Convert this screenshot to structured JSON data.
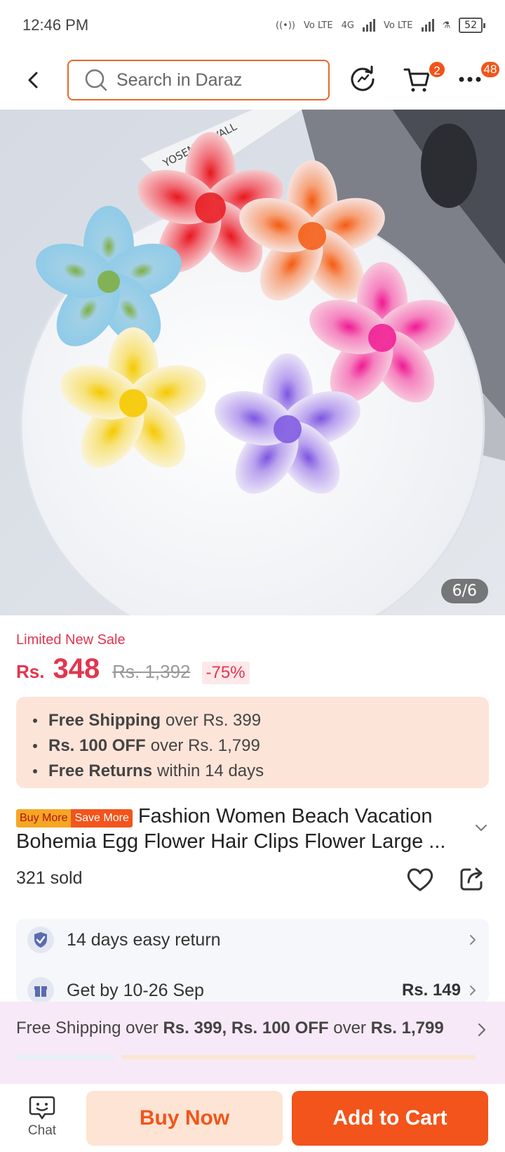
{
  "status_bar": {
    "time": "12:46 PM",
    "network_1": "Vo LTE",
    "network_2": "4G",
    "network_3": "Vo LTE",
    "battery": "52"
  },
  "header": {
    "search_placeholder": "Search in Daraz",
    "cart_count": "2",
    "more_count": "48"
  },
  "gallery": {
    "counter": "6/6",
    "sign_text": "YOSEMITE VALL"
  },
  "price": {
    "sale_label": "Limited New Sale",
    "currency": "Rs.",
    "current": "348",
    "original": "Rs. 1,392",
    "discount": "-75%"
  },
  "promos": [
    {
      "bold": "Free Shipping",
      "rest": "over Rs. 399"
    },
    {
      "bold": "Rs. 100 OFF",
      "rest": "over Rs. 1,799"
    },
    {
      "bold": "Free Returns",
      "rest": "within 14 days"
    }
  ],
  "product": {
    "badge_1": "Buy More",
    "badge_2": "Save More",
    "title": "Fashion Women Beach Vacation Bohemia Egg Flower Hair Clips Flower Large ...",
    "sold": "321 sold"
  },
  "service": {
    "return": "14 days easy return",
    "delivery": "Get by 10-26 Sep",
    "delivery_fee": "Rs. 149"
  },
  "shipping_banner": {
    "t1": "Free Shipping over",
    "b1": "Rs. 399, Rs. 100 OFF",
    "t2": "over",
    "b2": "Rs. 1,799"
  },
  "bottom": {
    "chat": "Chat",
    "buy_now": "Buy Now",
    "add_to_cart": "Add to Cart"
  },
  "colors": {
    "accent": "#f2541b",
    "price": "#e2364d",
    "search_border": "#e8672a"
  }
}
